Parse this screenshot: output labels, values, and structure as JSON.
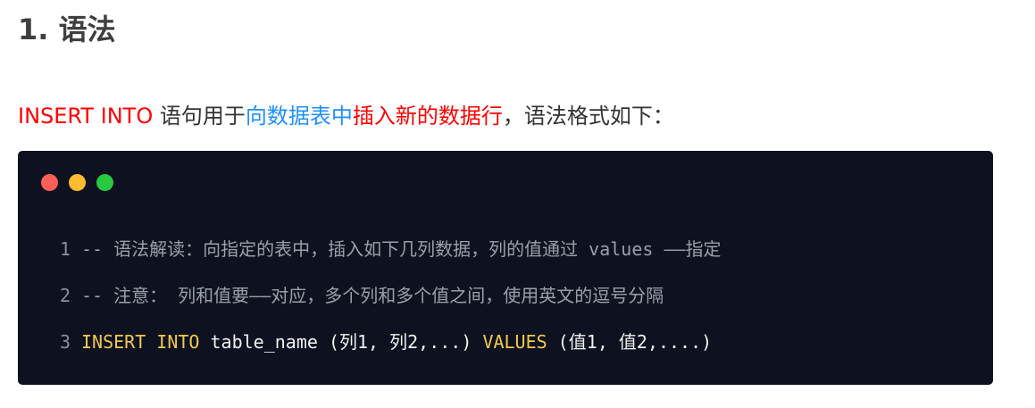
{
  "heading": "1. 语法",
  "intro": {
    "keyword": "INSERT INTO",
    "text1": " 语句用于",
    "highlight_blue": "向数据表中",
    "highlight_red": "插入新的数据行",
    "text2": "，语法格式如下："
  },
  "code_window": {
    "traffic_lights": [
      "#ff5f57",
      "#febc2e",
      "#28c840"
    ],
    "lines": [
      {
        "number": "1",
        "comment": "-- 语法解读：向指定的表中，插入如下几列数据，列的值通过 values ——指定"
      },
      {
        "number": "2",
        "comment": "-- 注意： 列和值要——对应，多个列和多个值之间，使用英文的逗号分隔"
      },
      {
        "number": "3",
        "kw1": "INSERT",
        "kw2": "INTO",
        "text1": "table_name (列1, 列2,...)",
        "kw3": "VALUES",
        "text2": "(值1, 值2,....)"
      }
    ]
  }
}
